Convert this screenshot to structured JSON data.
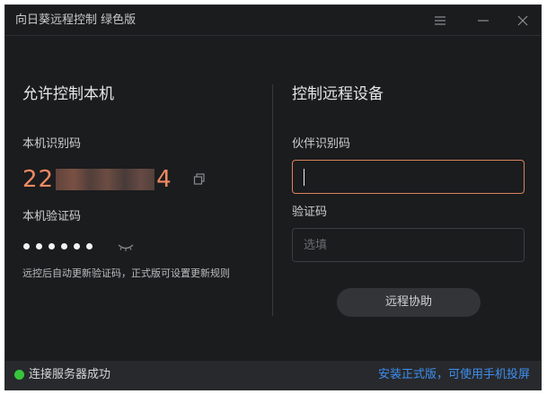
{
  "window": {
    "title": "向日葵远程控制 绿色版"
  },
  "left": {
    "section_title": "允许控制本机",
    "device_id_label": "本机识别码",
    "device_id_prefix": "22",
    "device_id_suffix": "4",
    "verify_label": "本机验证码",
    "verify_hint": "远控后自动更新验证码，正式版可设置更新规则"
  },
  "right": {
    "section_title": "控制远程设备",
    "partner_label": "伙伴识别码",
    "partner_value": "",
    "code_label": "验证码",
    "code_placeholder": "选填",
    "assist_button": "远程协助"
  },
  "status": {
    "connection_text": "连接服务器成功",
    "link_text": "安装正式版，可使用手机投屏"
  },
  "colors": {
    "accent": "#f08a62",
    "status_ok": "#37c53c",
    "link": "#3d8ff0"
  }
}
